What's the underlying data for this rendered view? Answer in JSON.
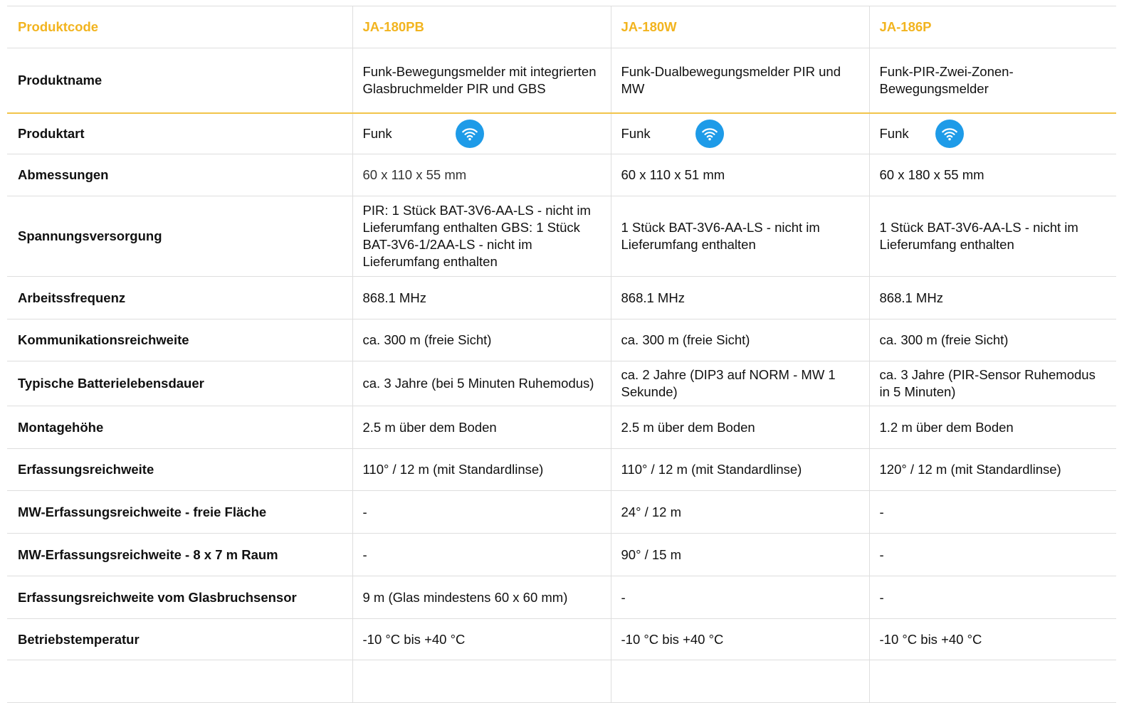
{
  "header": {
    "label": "Produktcode",
    "products": [
      "JA-180PB",
      "JA-180W",
      "JA-186P"
    ]
  },
  "product_type_row": {
    "label": "Produktart",
    "values": [
      "Funk",
      "Funk",
      "Funk"
    ],
    "icon": "wifi-icon",
    "icon_color": "#1e9be8"
  },
  "rows": [
    {
      "label": "Produktname",
      "values": [
        "Funk-Bewegungsmelder mit integrierten Glasbruchmelder PIR und GBS",
        "Funk-Dualbewegungsmelder PIR und MW",
        "Funk-PIR-Zwei-Zonen-Bewegungsmelder"
      ]
    },
    {
      "label": "Abmessungen",
      "values": [
        "60 x 110 x 55 mm",
        "60 x 110 x 51 mm",
        "60 x 180 x 55 mm"
      ]
    },
    {
      "label": "Spannungsversorgung",
      "values": [
        "PIR: 1 Stück BAT-3V6-AA-LS - nicht im Lieferumfang enthalten GBS: 1 Stück BAT-3V6-1/2AA-LS - nicht im Lieferumfang enthalten",
        "1 Stück BAT-3V6-AA-LS - nicht im Lieferumfang enthalten",
        "1 Stück BAT-3V6-AA-LS - nicht im Lieferumfang enthalten"
      ]
    },
    {
      "label": "Arbeitssfrequenz",
      "values": [
        "868.1 MHz",
        "868.1 MHz",
        "868.1 MHz"
      ]
    },
    {
      "label": "Kommunikationsreichweite",
      "values": [
        "ca. 300 m (freie Sicht)",
        "ca. 300 m (freie Sicht)",
        "ca. 300 m (freie Sicht)"
      ]
    },
    {
      "label": "Typische Batterielebensdauer",
      "values": [
        "ca. 3 Jahre (bei 5 Minuten Ruhemodus)",
        "ca. 2 Jahre (DIP3 auf NORM - MW 1 Sekunde)",
        "ca. 3 Jahre (PIR-Sensor Ruhemodus in 5 Minuten)"
      ]
    },
    {
      "label": "Montagehöhe",
      "values": [
        "2.5 m über dem Boden",
        "2.5 m über dem Boden",
        "1.2 m über dem Boden"
      ]
    },
    {
      "label": "Erfassungsreichweite",
      "values": [
        "110° / 12 m (mit Standardlinse)",
        "110° / 12 m (mit Standardlinse)",
        "120° / 12 m (mit Standardlinse)"
      ]
    },
    {
      "label": "MW-Erfassungsreichweite - freie Fläche",
      "values": [
        "-",
        "24° / 12 m",
        "-"
      ]
    },
    {
      "label": "MW-Erfassungsreichweite - 8 x 7 m Raum",
      "values": [
        "-",
        "90° / 15 m",
        "-"
      ]
    },
    {
      "label": "Erfassungsreichweite vom Glasbruchsensor",
      "values": [
        "9 m (Glas mindestens 60 x 60 mm)",
        "-",
        "-"
      ]
    },
    {
      "label": "Betriebstemperatur",
      "values": [
        "-10 °C bis +40 °C",
        "-10 °C bis +40 °C",
        "-10 °C bis +40 °C"
      ]
    }
  ],
  "colors": {
    "accent": "#f2b41f",
    "grid": "#dedede",
    "wifi_badge": "#1e9be8"
  }
}
